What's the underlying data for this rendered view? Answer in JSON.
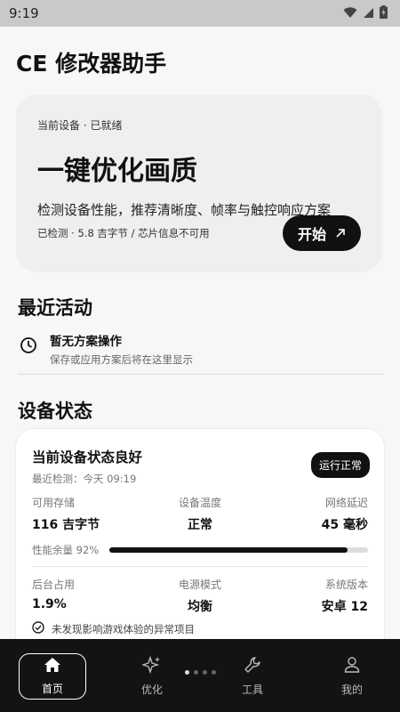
{
  "status_bar": {
    "time": "9:19"
  },
  "app": {
    "title": "CE 修改器助手"
  },
  "hero": {
    "status": "当前设备 · 已就绪",
    "title": "一键优化画质",
    "description": "检测设备性能，推荐清晰度、帧率与触控响应方案",
    "meta": "已检测 · 5.8 吉字节 / 芯片信息不可用",
    "start_label": "开始"
  },
  "recent": {
    "heading": "最近活动",
    "item_title": "暂无方案操作",
    "item_sub": "保存或应用方案后将在这里显示"
  },
  "device": {
    "heading": "设备状态",
    "card_title": "当前设备状态良好",
    "card_sub": "最近检测：今天 09:19",
    "badge": "运行正常",
    "stats_top": [
      {
        "label": "可用存储",
        "value": "116 吉字节"
      },
      {
        "label": "设备温度",
        "value": "正常"
      },
      {
        "label": "网络延迟",
        "value": "45 毫秒"
      }
    ],
    "perf_label": "性能余量 92%",
    "perf_value": 0.92,
    "stats_bottom": [
      {
        "label": "后台占用",
        "value": "1.9%"
      },
      {
        "label": "电源模式",
        "value": "均衡"
      },
      {
        "label": "系统版本",
        "value": "安卓 12"
      }
    ],
    "notice": "未发现影响游戏体验的异常项目"
  },
  "nav": {
    "items": [
      {
        "label": "首页",
        "icon": "home-icon"
      },
      {
        "label": "优化",
        "icon": "sparkle-icon"
      },
      {
        "label": "工具",
        "icon": "wrench-icon"
      },
      {
        "label": "我的",
        "icon": "person-icon"
      }
    ],
    "active": 0
  },
  "colors": {
    "accent": "#111111",
    "background": "#f7f7f7",
    "nav_bg": "#131313"
  }
}
